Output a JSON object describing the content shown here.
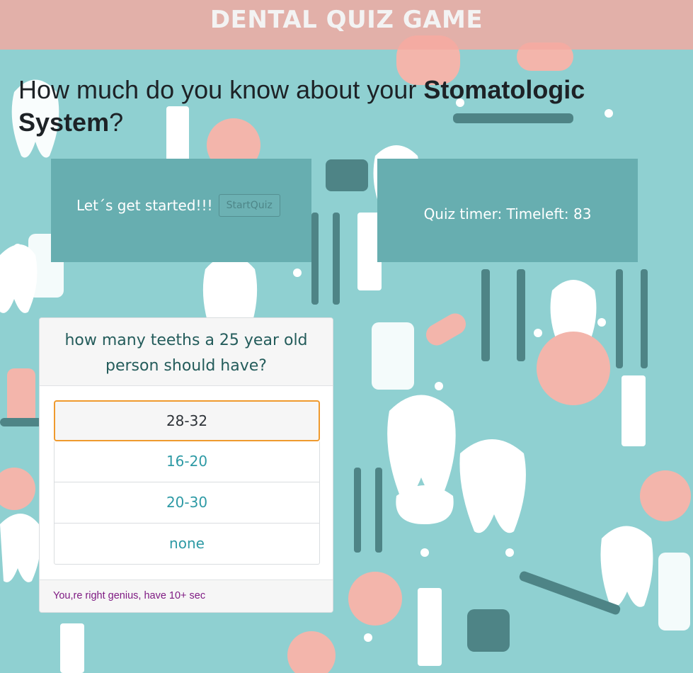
{
  "app": {
    "title": "DENTAL QUIZ GAME"
  },
  "headline": {
    "prefix": "How much do you know about your ",
    "emphasis": "Stomatologic System",
    "suffix": "?"
  },
  "start_panel": {
    "label": "Let´s get started!!!",
    "button_label": "StartQuiz"
  },
  "timer_panel": {
    "label": "Quiz timer: Timeleft: 83"
  },
  "quiz": {
    "question": "how many teeths a 25 year old person should have?",
    "options": [
      "28-32",
      "16-20",
      "20-30",
      "none"
    ],
    "feedback": "You,re right genius, have 10+ sec"
  },
  "colors": {
    "background": "#8fd0d1",
    "header": "#f4a8a0",
    "panel": "#67aeb0",
    "option_text": "#2e9aa5",
    "selected_border": "#ef9a2e",
    "feedback_text": "#7f1b83"
  }
}
